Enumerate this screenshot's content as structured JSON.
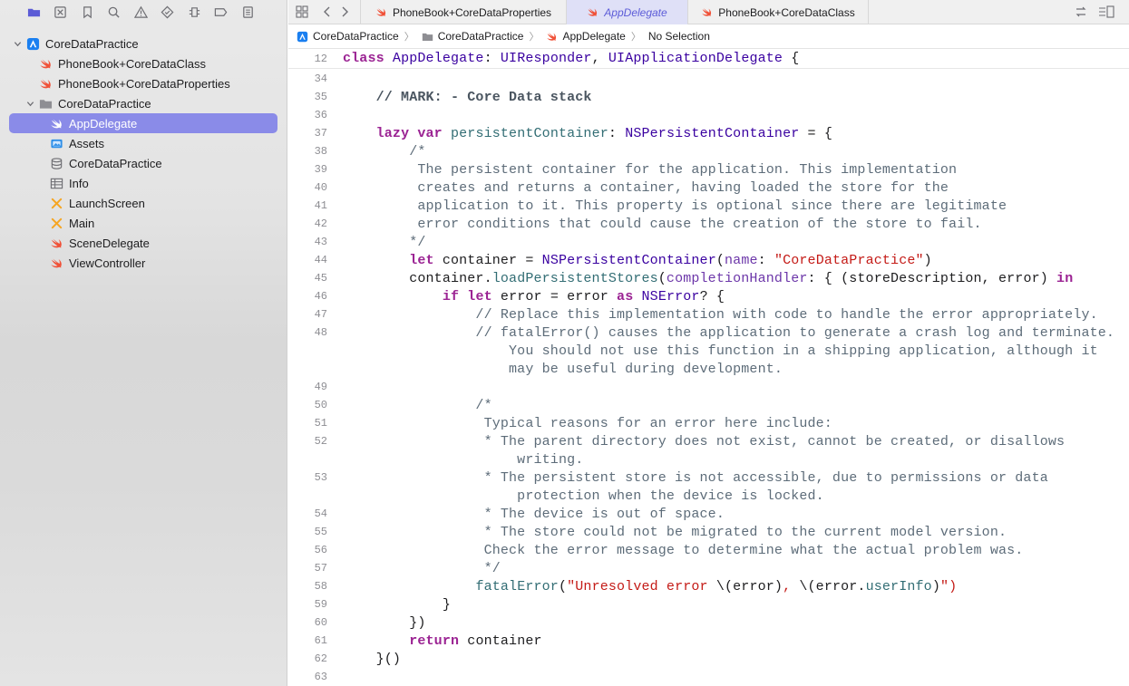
{
  "sidebar": {
    "toolbar_icons": [
      "folder-icon",
      "source-control-icon",
      "bookmark-icon",
      "find-icon",
      "issue-icon",
      "test-icon",
      "debug-icon",
      "breakpoint-icon",
      "report-icon"
    ],
    "tree": [
      {
        "label": "CoreDataPractice",
        "icon": "xcode-project-icon",
        "kind": "project"
      },
      {
        "label": "PhoneBook+CoreDataClass",
        "icon": "swift-file-icon",
        "kind": "file"
      },
      {
        "label": "PhoneBook+CoreDataProperties",
        "icon": "swift-file-icon",
        "kind": "file"
      },
      {
        "label": "CoreDataPractice",
        "icon": "folder-icon",
        "kind": "group"
      },
      {
        "label": "AppDelegate",
        "icon": "swift-file-icon",
        "kind": "file",
        "selected": true
      },
      {
        "label": "Assets",
        "icon": "asset-catalog-icon",
        "kind": "file"
      },
      {
        "label": "CoreDataPractice",
        "icon": "data-model-icon",
        "kind": "file"
      },
      {
        "label": "Info",
        "icon": "plist-icon",
        "kind": "file"
      },
      {
        "label": "LaunchScreen",
        "icon": "storyboard-icon",
        "kind": "file"
      },
      {
        "label": "Main",
        "icon": "storyboard-icon",
        "kind": "file"
      },
      {
        "label": "SceneDelegate",
        "icon": "swift-file-icon",
        "kind": "file"
      },
      {
        "label": "ViewController",
        "icon": "swift-file-icon",
        "kind": "file"
      }
    ]
  },
  "tabs": [
    {
      "label": "PhoneBook+CoreDataProperties",
      "active": false
    },
    {
      "label": "AppDelegate",
      "active": true
    },
    {
      "label": "PhoneBook+CoreDataClass",
      "active": false
    }
  ],
  "jumpbar": {
    "project": "CoreDataPractice",
    "group": "CoreDataPractice",
    "file": "AppDelegate",
    "selection": "No Selection"
  },
  "editor": {
    "sticky_line": {
      "num": "12",
      "text": "class AppDelegate: UIResponder, UIApplicationDelegate {"
    },
    "lines": [
      {
        "num": "34",
        "text": ""
      },
      {
        "num": "35",
        "text": "    // MARK: - Core Data stack"
      },
      {
        "num": "36",
        "text": ""
      },
      {
        "num": "37",
        "text": "    lazy var persistentContainer: NSPersistentContainer = {"
      },
      {
        "num": "38",
        "text": "        /*"
      },
      {
        "num": "39",
        "text": "         The persistent container for the application. This implementation"
      },
      {
        "num": "40",
        "text": "         creates and returns a container, having loaded the store for the"
      },
      {
        "num": "41",
        "text": "         application to it. This property is optional since there are legitimate"
      },
      {
        "num": "42",
        "text": "         error conditions that could cause the creation of the store to fail."
      },
      {
        "num": "43",
        "text": "        */"
      },
      {
        "num": "44",
        "text": "        let container = NSPersistentContainer(name: \"CoreDataPractice\")"
      },
      {
        "num": "45",
        "text": "        container.loadPersistentStores(completionHandler: { (storeDescription, error) in"
      },
      {
        "num": "46",
        "text": "            if let error = error as NSError? {"
      },
      {
        "num": "47",
        "text": "                // Replace this implementation with code to handle the error appropriately."
      },
      {
        "num": "48",
        "text": "                // fatalError() causes the application to generate a crash log and terminate."
      },
      {
        "num": "",
        "text": "                    You should not use this function in a shipping application, although it"
      },
      {
        "num": "",
        "text": "                    may be useful during development."
      },
      {
        "num": "49",
        "text": ""
      },
      {
        "num": "50",
        "text": "                /*"
      },
      {
        "num": "51",
        "text": "                 Typical reasons for an error here include:"
      },
      {
        "num": "52",
        "text": "                 * The parent directory does not exist, cannot be created, or disallows"
      },
      {
        "num": "",
        "text": "                     writing."
      },
      {
        "num": "53",
        "text": "                 * The persistent store is not accessible, due to permissions or data"
      },
      {
        "num": "",
        "text": "                     protection when the device is locked."
      },
      {
        "num": "54",
        "text": "                 * The device is out of space."
      },
      {
        "num": "55",
        "text": "                 * The store could not be migrated to the current model version."
      },
      {
        "num": "56",
        "text": "                 Check the error message to determine what the actual problem was."
      },
      {
        "num": "57",
        "text": "                 */"
      },
      {
        "num": "58",
        "text": "                fatalError(\"Unresolved error \\(error), \\(error.userInfo)\")"
      },
      {
        "num": "59",
        "text": "            }"
      },
      {
        "num": "60",
        "text": "        })"
      },
      {
        "num": "61",
        "text": "        return container"
      },
      {
        "num": "62",
        "text": "    }()"
      },
      {
        "num": "63",
        "text": ""
      }
    ]
  },
  "colors": {
    "keyword": "#9b2393",
    "type": "#3900a0",
    "function": "#326d74",
    "string": "#c41a16",
    "comment": "#5d6c79",
    "selection": "#8a8be8",
    "swift_icon": "#f05138"
  }
}
